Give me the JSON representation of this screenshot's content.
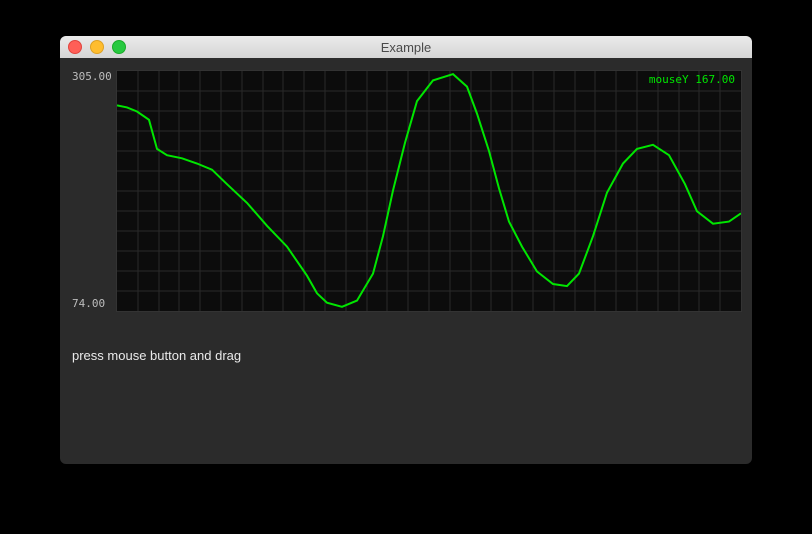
{
  "window": {
    "title": "Example"
  },
  "plot": {
    "y_max_label": "305.00",
    "y_min_label": "74.00",
    "mouse_label": "mouseY 167.00"
  },
  "instructions": "press mouse button and drag",
  "chart_data": {
    "type": "line",
    "title": "",
    "xlabel": "",
    "ylabel": "mouseY",
    "xlim": [
      0,
      624
    ],
    "ylim": [
      74,
      305
    ],
    "series": [
      {
        "name": "mouseY",
        "color": "#00e600",
        "x": [
          0,
          10,
          20,
          32,
          40,
          50,
          65,
          80,
          95,
          110,
          130,
          150,
          170,
          190,
          200,
          210,
          225,
          240,
          256,
          266,
          276,
          288,
          300,
          316,
          336,
          350,
          360,
          372,
          382,
          392,
          405,
          420,
          436,
          450,
          462,
          476,
          490,
          506,
          520,
          536,
          552,
          568,
          580,
          596,
          612,
          624
        ],
        "values": [
          272,
          270,
          266,
          258,
          230,
          224,
          221,
          216,
          210,
          196,
          178,
          156,
          136,
          108,
          91,
          82,
          78,
          84,
          110,
          146,
          190,
          236,
          276,
          296,
          302,
          290,
          264,
          228,
          192,
          160,
          136,
          112,
          100,
          98,
          110,
          146,
          188,
          216,
          230,
          234,
          224,
          196,
          170,
          158,
          160,
          168
        ]
      }
    ],
    "grid": {
      "x_divisions": 30,
      "y_divisions": 12
    }
  }
}
